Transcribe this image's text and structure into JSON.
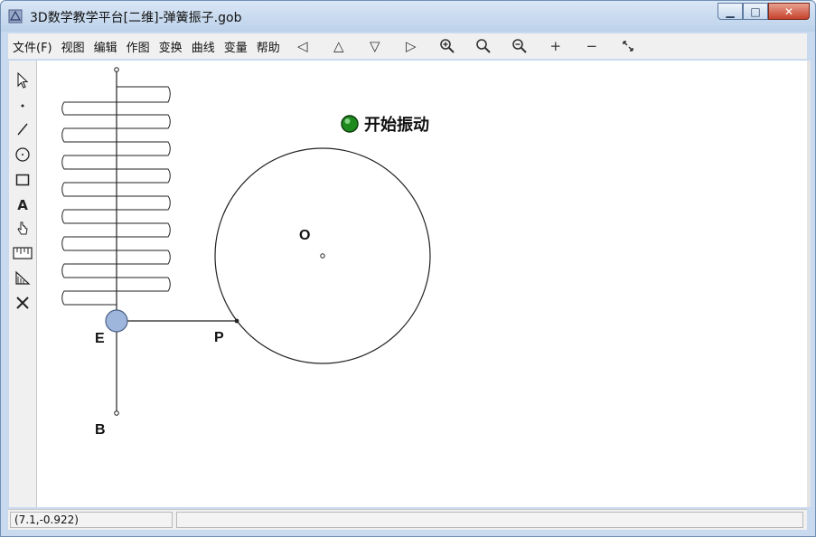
{
  "window": {
    "title": "3D数学教学平台[二维]-弹簧振子.gob"
  },
  "menubar": {
    "items": [
      "文件(F)",
      "视图",
      "编辑",
      "作图",
      "变换",
      "曲线",
      "变量",
      "帮助"
    ],
    "tool_icons": [
      "◁",
      "△",
      "▽",
      "▷",
      "zoom-in-icon",
      "zoom-fit-icon",
      "zoom-out-icon",
      "+",
      "−",
      "fit-icon"
    ]
  },
  "canvas": {
    "button_label": "开始振动",
    "labels": {
      "O": "O",
      "E": "E",
      "P": "P",
      "B": "B"
    }
  },
  "status": {
    "coords": "(7.1,-0.922)"
  }
}
